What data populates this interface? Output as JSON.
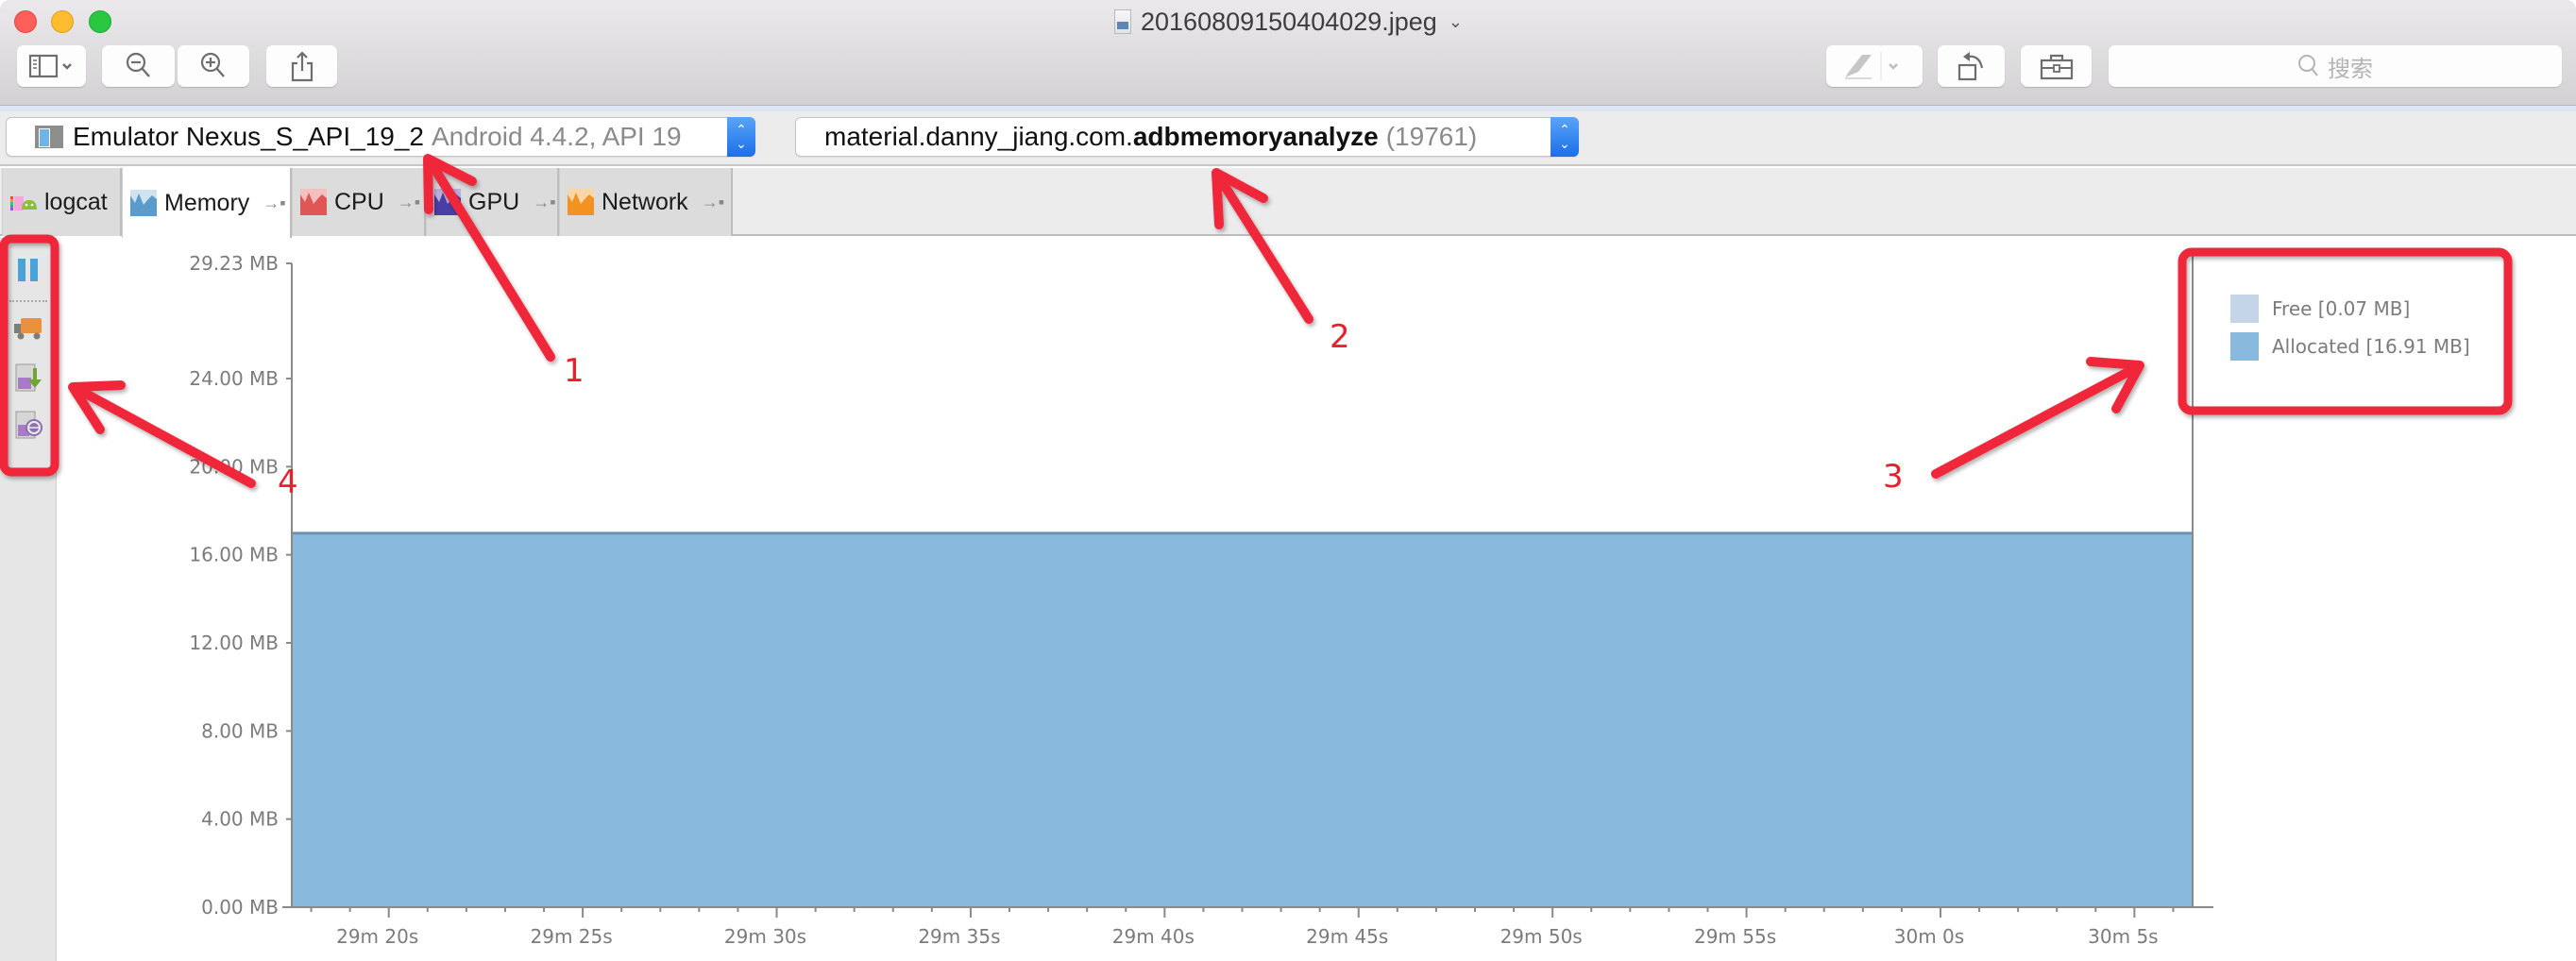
{
  "window": {
    "title": "20160809150404029.jpeg",
    "search_placeholder": "搜索"
  },
  "toolbar": {
    "buttons": [
      {
        "name": "sidebar-toggle",
        "icon": "sidebar-icon"
      },
      {
        "name": "zoom-out",
        "icon": "zoom-out-icon"
      },
      {
        "name": "zoom-in",
        "icon": "zoom-in-icon"
      },
      {
        "name": "share",
        "icon": "share-icon"
      },
      {
        "name": "markup",
        "icon": "pen-icon"
      },
      {
        "name": "rotate",
        "icon": "rotate-left-icon"
      },
      {
        "name": "toolbox",
        "icon": "toolbox-icon"
      }
    ]
  },
  "device_selector": {
    "device_name": "Emulator Nexus_S_API_19_2",
    "device_detail": "Android 4.4.2, API 19"
  },
  "process_selector": {
    "package_prefix": "material.danny_jiang.com.",
    "package_bold": "adbmemoryanalyze",
    "pid": "(19761)"
  },
  "tabs": [
    {
      "label": "logcat",
      "active": false,
      "detachable": false
    },
    {
      "label": "Memory",
      "active": true,
      "detachable": true
    },
    {
      "label": "CPU",
      "active": false,
      "detachable": true
    },
    {
      "label": "GPU",
      "active": false,
      "detachable": true
    },
    {
      "label": "Network",
      "active": false,
      "detachable": true
    }
  ],
  "tab_detach_glyph": "→▪",
  "side_toolbar": [
    {
      "name": "pause-monitor",
      "icon": "pause-icon"
    },
    {
      "name": "initiate-gc",
      "icon": "garbage-truck-icon"
    },
    {
      "name": "dump-java-heap",
      "icon": "heap-dump-icon"
    },
    {
      "name": "allocation-tracker",
      "icon": "allocation-tracker-icon"
    }
  ],
  "colors": {
    "allocated": "#8ab9de",
    "allocated_line": "#6b8fb0",
    "free": "#c3d5e6",
    "axis": "#8a8a8a",
    "annotation": "#f0283a"
  },
  "chart_data": {
    "type": "area",
    "title": "",
    "xlabel": "",
    "ylabel": "",
    "ylim": [
      0,
      29.23
    ],
    "y_ticks": [
      0,
      4,
      8,
      12,
      16,
      20,
      24,
      29.23
    ],
    "y_tick_labels": [
      "0.00 MB",
      "4.00 MB",
      "8.00 MB",
      "12.00 MB",
      "16.00 MB",
      "20.00 MB",
      "24.00 MB",
      "29.23 MB"
    ],
    "x_range_seconds": [
      1757.5,
      1806.5
    ],
    "x_ticks_seconds": [
      1760,
      1765,
      1770,
      1775,
      1780,
      1785,
      1790,
      1795,
      1800,
      1805
    ],
    "x_tick_labels": [
      "29m 20s",
      "29m 25s",
      "29m 30s",
      "29m 35s",
      "29m 40s",
      "29m 45s",
      "29m 50s",
      "29m 55s",
      "30m 0s",
      "30m 5s"
    ],
    "x_minor_tick_interval_seconds": 1,
    "grid": false,
    "legend_position": "top-right",
    "series": [
      {
        "name": "Allocated",
        "legend_label": "Allocated [16.91 MB]",
        "x": [
          1757.5,
          1806.5
        ],
        "values": [
          16.91,
          16.91
        ]
      },
      {
        "name": "Free",
        "legend_label": "Free [0.07 MB]",
        "x": [
          1757.5,
          1806.5
        ],
        "values": [
          0.07,
          0.07
        ]
      }
    ]
  },
  "annotations": [
    {
      "label": "1",
      "target": "device-selector"
    },
    {
      "label": "2",
      "target": "process-selector"
    },
    {
      "label": "3",
      "target": "legend"
    },
    {
      "label": "4",
      "target": "side-toolbar"
    }
  ]
}
